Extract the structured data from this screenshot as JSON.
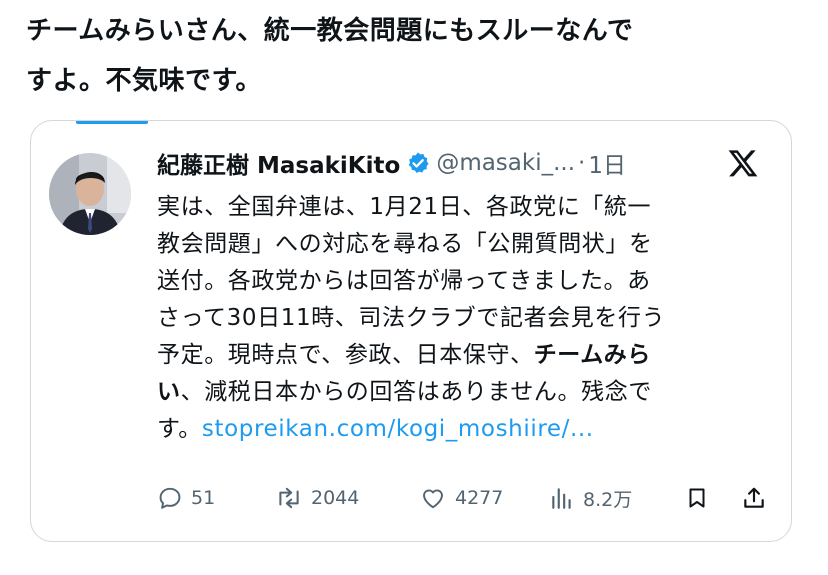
{
  "headline": {
    "line1": "チームみらいさん、統一教会問題にもスルーなんで",
    "line2": "すよ。不気味です。"
  },
  "tweet": {
    "author_name": "紀藤正樹 MasakiKito",
    "handle": "@masaki_...",
    "separator": "·",
    "time": "1日",
    "lines": {
      "l1": "実は、全国弁連は、1月21日、各政党に「統一",
      "l2": "教会問題」への対応を尋ねる「公開質問状」を",
      "l3": "送付。各政党からは回答が帰ってきました。あ",
      "l4": "さって30日11時、司法クラブで記者会見を行う",
      "l5a": "予定。現時点で、参政、日本保守、",
      "l5b": "チームみら",
      "l6a": "い",
      "l6b": "、減税日本からの回答はありません。残念で",
      "l7a": "す。",
      "l7b": "stopreikan.com/kogi_moshiire/..."
    },
    "actions": {
      "replies": "51",
      "reposts": "2044",
      "likes": "4277",
      "views": "8.2万"
    }
  },
  "icons": {
    "verified": "verified-badge-icon",
    "x": "x-logo-icon",
    "reply": "reply-icon",
    "repost": "repost-icon",
    "like": "like-icon",
    "views": "views-icon",
    "bookmark": "bookmark-icon",
    "share": "share-icon"
  },
  "colors": {
    "accent": "#1d9bf0",
    "text": "#0f1419",
    "muted": "#536471",
    "border": "#cfd9de"
  }
}
